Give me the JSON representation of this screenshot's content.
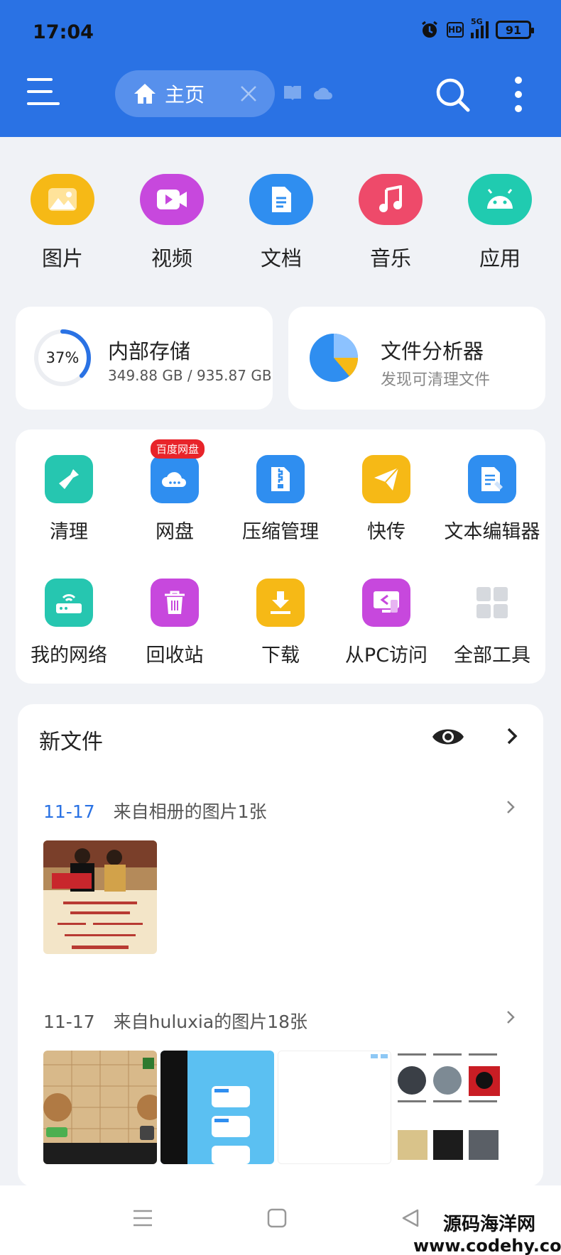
{
  "status_bar": {
    "time": "17:04",
    "network": "5G",
    "hd": "HD",
    "battery": "91"
  },
  "header": {
    "home_tab_label": "主页"
  },
  "categories": [
    {
      "label": "图片",
      "icon": "image-icon",
      "color": "#f6b916"
    },
    {
      "label": "视频",
      "icon": "video-icon",
      "color": "#c748dd"
    },
    {
      "label": "文档",
      "icon": "document-icon",
      "color": "#2f8ef0"
    },
    {
      "label": "音乐",
      "icon": "music-icon",
      "color": "#ee4a6a"
    },
    {
      "label": "应用",
      "icon": "android-icon",
      "color": "#20cbb0"
    }
  ],
  "storage": {
    "percent_label": "37%",
    "percent": 37,
    "title": "内部存储",
    "usage": "349.88 GB / 935.87 GB"
  },
  "analyzer": {
    "title": "文件分析器",
    "subtitle": "发现可清理文件"
  },
  "tools": {
    "badge": "百度网盘",
    "items": [
      {
        "label": "清理",
        "icon": "broom-icon",
        "color": "#26c6b0"
      },
      {
        "label": "网盘",
        "icon": "cloud-drive-icon",
        "color": "#2f8ef0"
      },
      {
        "label": "压缩管理",
        "icon": "zip-icon",
        "color": "#2f8ef0"
      },
      {
        "label": "快传",
        "icon": "send-icon",
        "color": "#f6b916"
      },
      {
        "label": "文本编辑器",
        "icon": "text-editor-icon",
        "color": "#2f8ef0"
      },
      {
        "label": "我的网络",
        "icon": "router-icon",
        "color": "#26c6b0"
      },
      {
        "label": "回收站",
        "icon": "trash-icon",
        "color": "#c748dd"
      },
      {
        "label": "下载",
        "icon": "download-icon",
        "color": "#f6b916"
      },
      {
        "label": "从PC访问",
        "icon": "pc-access-icon",
        "color": "#c748dd"
      },
      {
        "label": "全部工具",
        "icon": "grid-icon",
        "color": "#d6d9de"
      }
    ]
  },
  "new_files": {
    "title": "新文件",
    "groups": [
      {
        "date": "11-17",
        "description": "来自相册的图片1张"
      },
      {
        "date": "11-17",
        "description": "来自huluxia的图片18张"
      }
    ]
  },
  "watermark": {
    "name": "源码海洋网",
    "url": "www.codehy.com"
  }
}
